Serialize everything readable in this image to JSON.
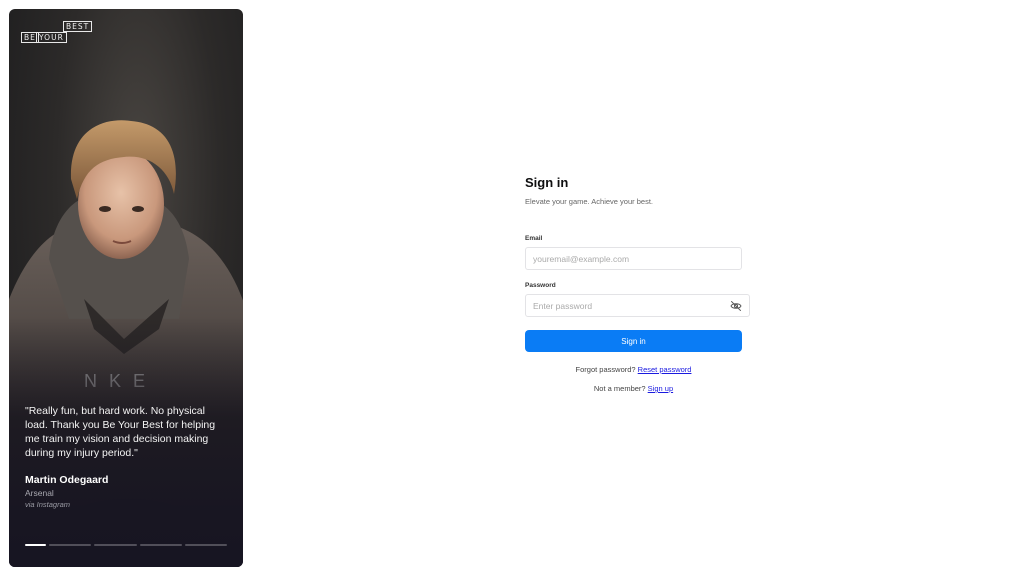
{
  "brand": {
    "logo_words": [
      "BE",
      "YOUR",
      "BEST"
    ]
  },
  "testimonial": {
    "quote": "\"Really fun, but hard work. No physical load. Thank you Be Your Best for helping me train my vision and decision making during my injury period.\"",
    "name": "Martin Odegaard",
    "team": "Arsenal",
    "via": "via Instagram",
    "slide_count": 5,
    "active_slide": 1
  },
  "signin": {
    "title": "Sign in",
    "subtitle": "Elevate your game. Achieve your best.",
    "email_label": "Email",
    "email_placeholder": "youremail@example.com",
    "password_label": "Password",
    "password_placeholder": "Enter password",
    "password_toggle_icon": "eye-off-icon",
    "submit_label": "Sign in",
    "forgot_text": "Forgot password?",
    "reset_link": "Reset password",
    "member_text": "Not a member?",
    "signup_link": "Sign up"
  },
  "colors": {
    "primary": "#0a7cf5",
    "link": "#1a1ae0"
  }
}
